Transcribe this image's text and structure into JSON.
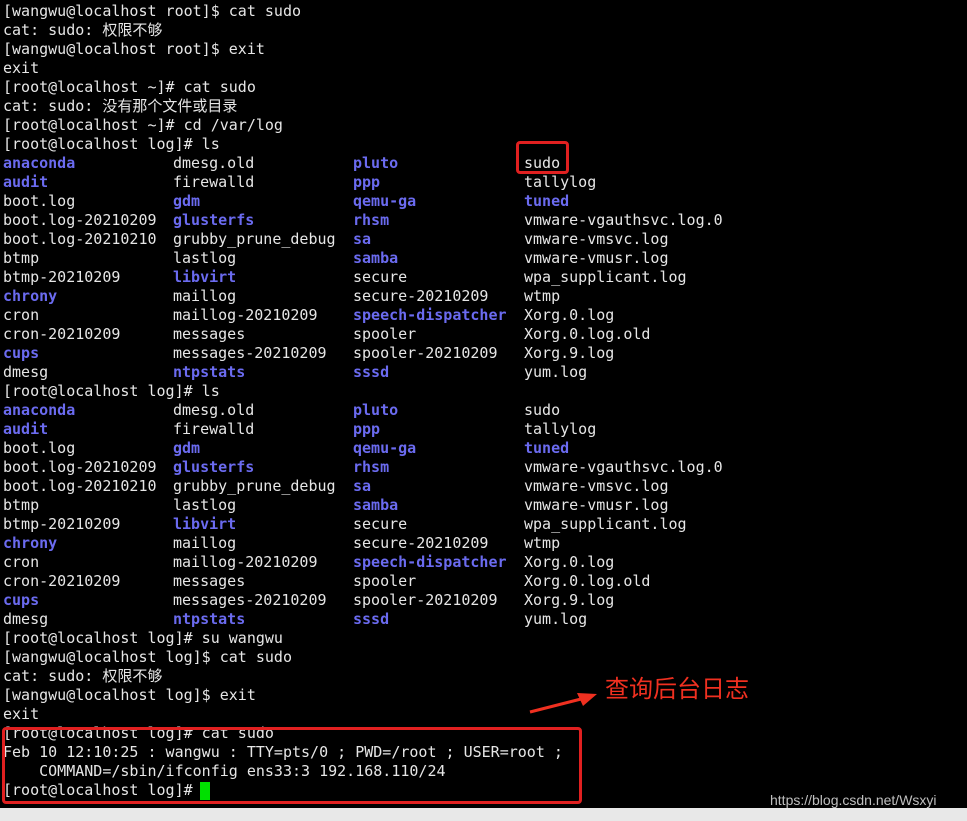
{
  "terminal": {
    "lines_top": [
      "[wangwu@localhost root]$ cat sudo",
      "cat: sudo: 权限不够",
      "[wangwu@localhost root]$ exit",
      "exit",
      "[root@localhost ~]# cat sudo",
      "cat: sudo: 没有那个文件或目录",
      "[root@localhost ~]# cd /var/log",
      "[root@localhost log]# ls"
    ],
    "ls_1": [
      [
        {
          "t": "anaconda",
          "d": true
        },
        {
          "t": "dmesg.old",
          "d": false
        },
        {
          "t": "pluto",
          "d": true
        },
        {
          "t": "sudo",
          "d": false
        }
      ],
      [
        {
          "t": "audit",
          "d": true
        },
        {
          "t": "firewalld",
          "d": false
        },
        {
          "t": "ppp",
          "d": true
        },
        {
          "t": "tallylog",
          "d": false
        }
      ],
      [
        {
          "t": "boot.log",
          "d": false
        },
        {
          "t": "gdm",
          "d": true
        },
        {
          "t": "qemu-ga",
          "d": true
        },
        {
          "t": "tuned",
          "d": true
        }
      ],
      [
        {
          "t": "boot.log-20210209",
          "d": false
        },
        {
          "t": "glusterfs",
          "d": true
        },
        {
          "t": "rhsm",
          "d": true
        },
        {
          "t": "vmware-vgauthsvc.log.0",
          "d": false
        }
      ],
      [
        {
          "t": "boot.log-20210210",
          "d": false
        },
        {
          "t": "grubby_prune_debug",
          "d": false
        },
        {
          "t": "sa",
          "d": true
        },
        {
          "t": "vmware-vmsvc.log",
          "d": false
        }
      ],
      [
        {
          "t": "btmp",
          "d": false
        },
        {
          "t": "lastlog",
          "d": false
        },
        {
          "t": "samba",
          "d": true
        },
        {
          "t": "vmware-vmusr.log",
          "d": false
        }
      ],
      [
        {
          "t": "btmp-20210209",
          "d": false
        },
        {
          "t": "libvirt",
          "d": true
        },
        {
          "t": "secure",
          "d": false
        },
        {
          "t": "wpa_supplicant.log",
          "d": false
        }
      ],
      [
        {
          "t": "chrony",
          "d": true
        },
        {
          "t": "maillog",
          "d": false
        },
        {
          "t": "secure-20210209",
          "d": false
        },
        {
          "t": "wtmp",
          "d": false
        }
      ],
      [
        {
          "t": "cron",
          "d": false
        },
        {
          "t": "maillog-20210209",
          "d": false
        },
        {
          "t": "speech-dispatcher",
          "d": true
        },
        {
          "t": "Xorg.0.log",
          "d": false
        }
      ],
      [
        {
          "t": "cron-20210209",
          "d": false
        },
        {
          "t": "messages",
          "d": false
        },
        {
          "t": "spooler",
          "d": false
        },
        {
          "t": "Xorg.0.log.old",
          "d": false
        }
      ],
      [
        {
          "t": "cups",
          "d": true
        },
        {
          "t": "messages-20210209",
          "d": false
        },
        {
          "t": "spooler-20210209",
          "d": false
        },
        {
          "t": "Xorg.9.log",
          "d": false
        }
      ],
      [
        {
          "t": "dmesg",
          "d": false
        },
        {
          "t": "ntpstats",
          "d": true
        },
        {
          "t": "sssd",
          "d": true
        },
        {
          "t": "yum.log",
          "d": false
        }
      ]
    ],
    "prompt_ls_2": "[root@localhost log]# ls",
    "lines_bottom": [
      "[root@localhost log]# su wangwu",
      "[wangwu@localhost log]$ cat sudo",
      "cat: sudo: 权限不够",
      "[wangwu@localhost log]$ exit",
      "exit",
      "[root@localhost log]# cat sudo",
      "Feb 10 12:10:25 : wangwu : TTY=pts/0 ; PWD=/root ; USER=root ;",
      "    COMMAND=/sbin/ifconfig ens33:3 192.168.110/24",
      "[root@localhost log]# "
    ]
  },
  "annotation": "查询后台日志",
  "watermark": "https://blog.csdn.net/Wsxyi",
  "colors": {
    "background": "#000000",
    "text": "#e6e6e6",
    "directory": "#6b6bf0",
    "cursor": "#00e000",
    "highlight": "#e02020"
  }
}
